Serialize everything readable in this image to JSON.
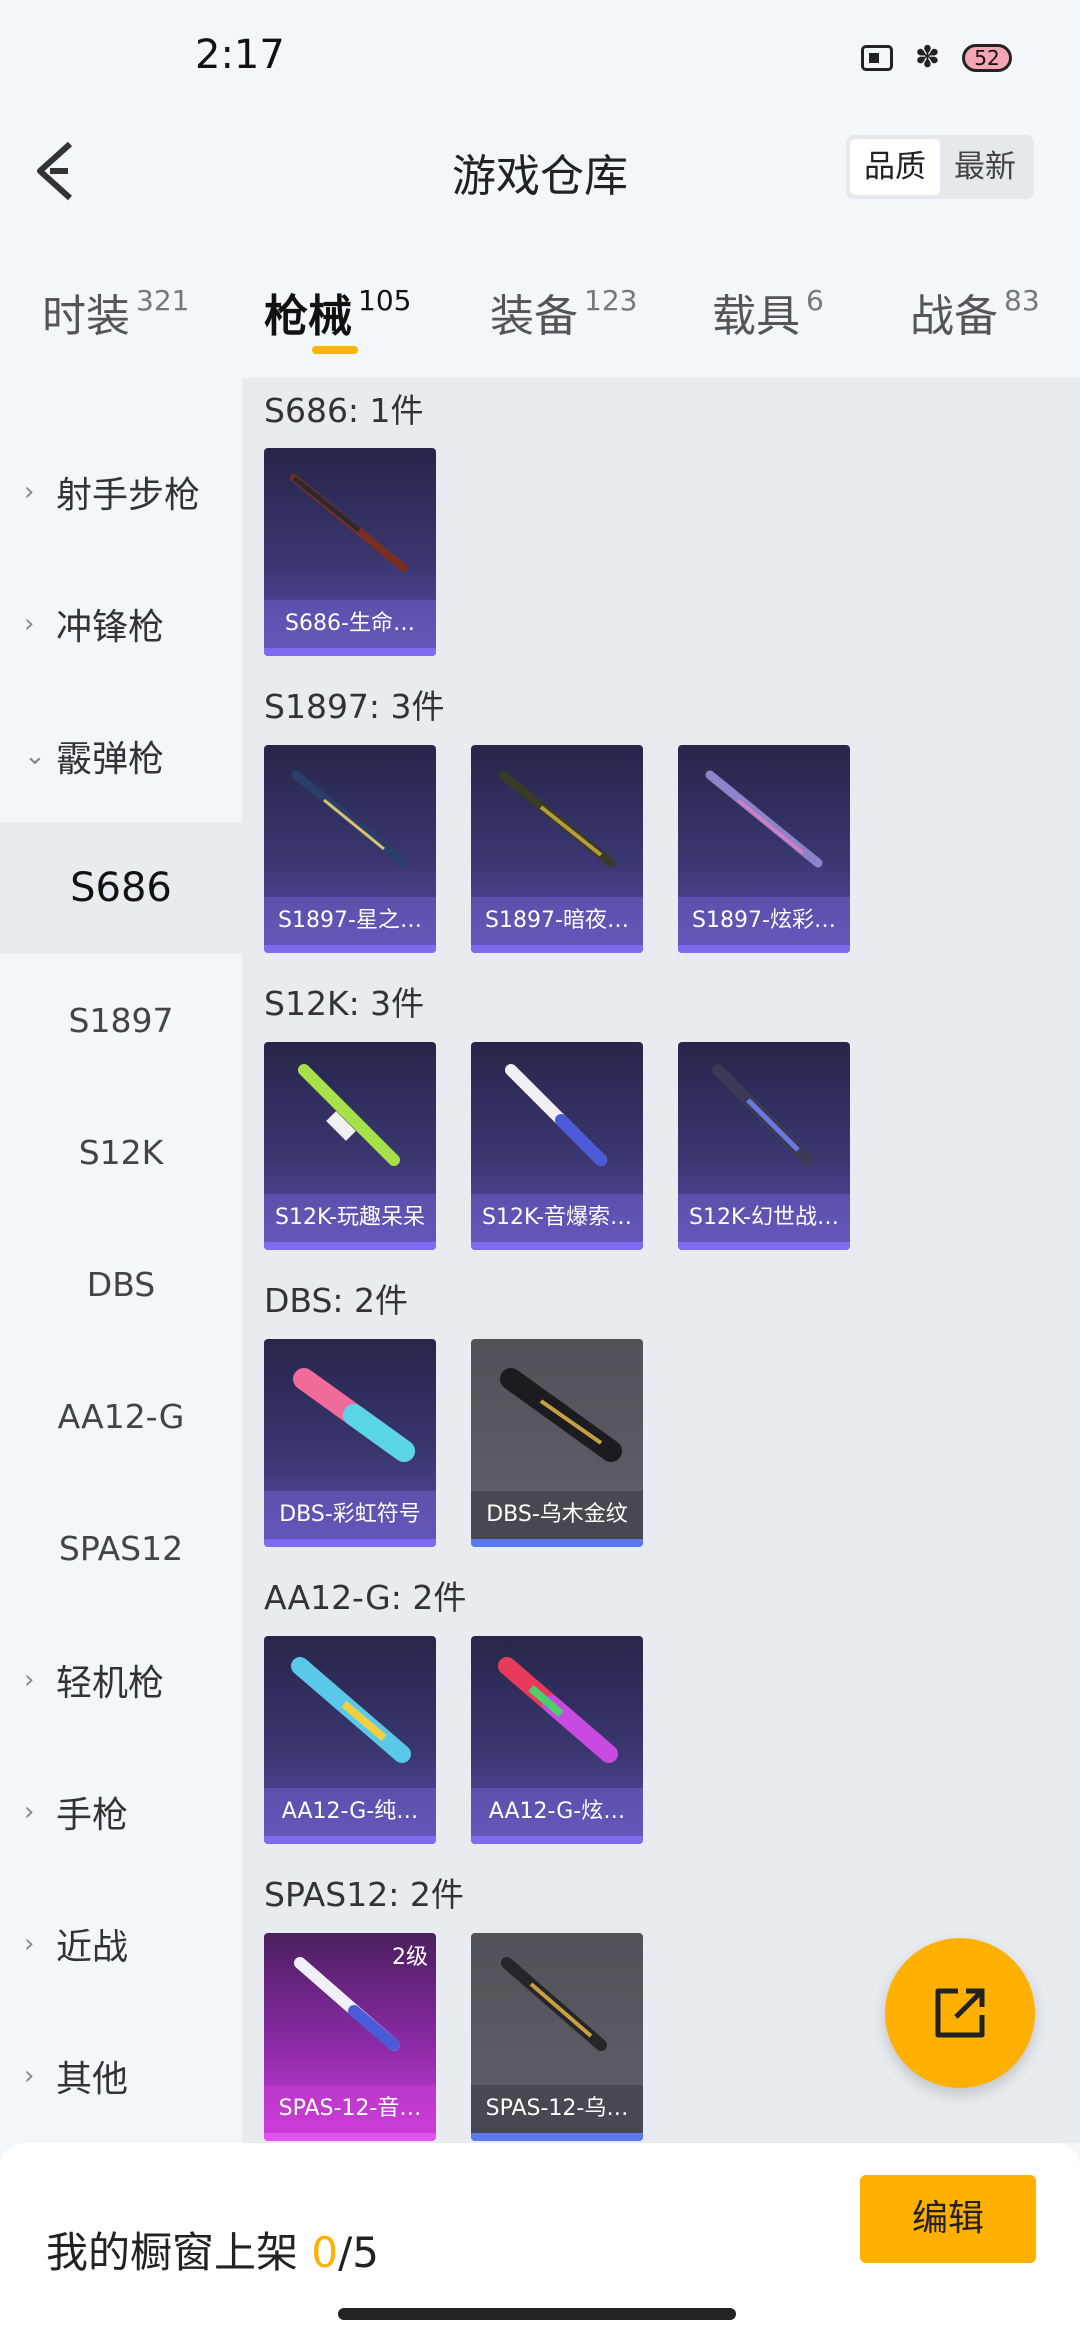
{
  "status": {
    "time": "2:17",
    "battery": "52"
  },
  "header": {
    "title": "游戏仓库",
    "sort_quality": "品质",
    "sort_newest": "最新"
  },
  "tabs": [
    {
      "label": "时装",
      "count": "321"
    },
    {
      "label": "枪械",
      "count": "105"
    },
    {
      "label": "装备",
      "count": "123"
    },
    {
      "label": "载具",
      "count": "6"
    },
    {
      "label": "战备",
      "count": "83"
    }
  ],
  "sidebar": {
    "cat_sniper": "射手步枪",
    "cat_smg": "冲锋枪",
    "cat_shotgun": "霰弹枪",
    "sub_s686": "S686",
    "sub_s1897": "S1897",
    "sub_s12k": "S12K",
    "sub_dbs": "DBS",
    "sub_aa12g": "AA12-G",
    "sub_spas12": "SPAS12",
    "cat_lmg": "轻机枪",
    "cat_pistol": "手枪",
    "cat_melee": "近战",
    "cat_other": "其他"
  },
  "sections": {
    "s686": {
      "title": "S686: 1件",
      "items": [
        "S686-生命…"
      ]
    },
    "s1897": {
      "title": "S1897: 3件",
      "items": [
        "S1897-星之…",
        "S1897-暗夜…",
        "S1897-炫彩…"
      ]
    },
    "s12k": {
      "title": "S12K: 3件",
      "items": [
        "S12K-玩趣呆呆",
        "S12K-音爆索…",
        "S12K-幻世战…"
      ]
    },
    "dbs": {
      "title": "DBS: 2件",
      "items": [
        "DBS-彩虹符号",
        "DBS-乌木金纹"
      ]
    },
    "aa12g": {
      "title": "AA12-G: 2件",
      "items": [
        "AA12-G-纯…",
        "AA12-G-炫…"
      ]
    },
    "spas12": {
      "title": "SPAS12: 2件",
      "items": [
        "SPAS-12-音…",
        "SPAS-12-乌…"
      ],
      "level": "2级"
    }
  },
  "bottom": {
    "showcase_label": "我的橱窗上架",
    "showcase_current": "0",
    "showcase_total": "/5",
    "edit_label": "编辑"
  },
  "colors": {
    "accent": "#ffb000",
    "purple_rarity": "#7b6cf0",
    "pink_rarity": "#e254f0"
  }
}
